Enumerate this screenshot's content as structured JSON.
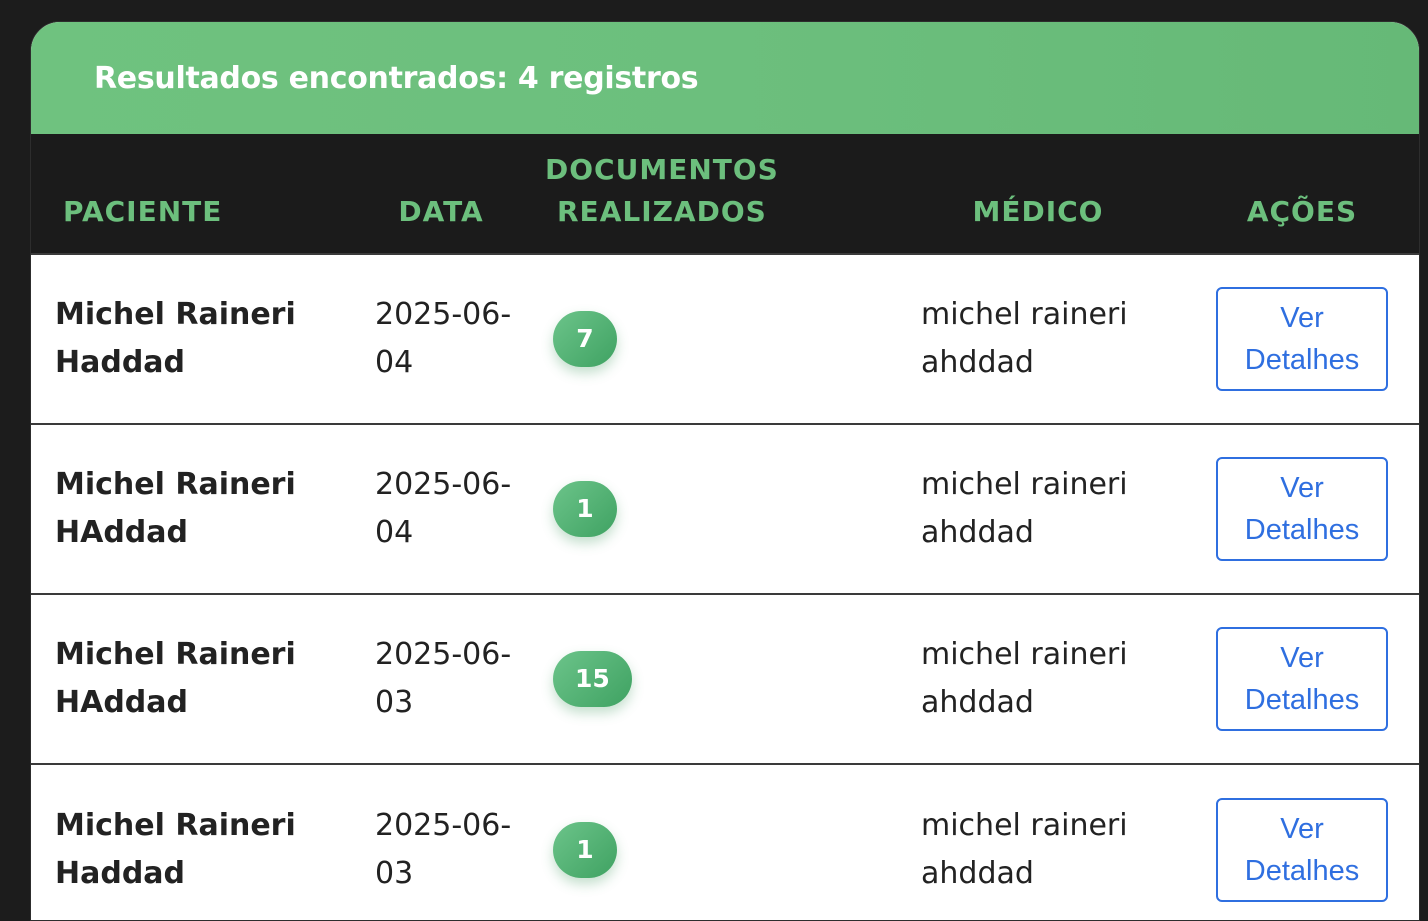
{
  "results": {
    "title": "Resultados encontrados: 4 registros"
  },
  "table": {
    "headers": {
      "paciente": "PACIENTE",
      "data": "DATA",
      "documentos_line1": "DOCUMENTOS",
      "documentos_line2": "REALIZADOS",
      "medico": "MÉDICO",
      "acoes": "AÇÕES"
    },
    "rows": [
      {
        "paciente_line1": "Michel Raineri",
        "paciente_line2": "Haddad",
        "data_line1": "2025-06-",
        "data_line2": "04",
        "documentos": "7",
        "medico_line1": "michel raineri",
        "medico_line2": "ahddad",
        "action_line1": "Ver",
        "action_line2": "Detalhes"
      },
      {
        "paciente_line1": "Michel Raineri",
        "paciente_line2": "HAddad",
        "data_line1": "2025-06-",
        "data_line2": "04",
        "documentos": "1",
        "medico_line1": "michel raineri",
        "medico_line2": "ahddad",
        "action_line1": "Ver",
        "action_line2": "Detalhes"
      },
      {
        "paciente_line1": "Michel Raineri",
        "paciente_line2": "HAddad",
        "data_line1": "2025-06-",
        "data_line2": "03",
        "documentos": "15",
        "medico_line1": "michel raineri",
        "medico_line2": "ahddad",
        "action_line1": "Ver",
        "action_line2": "Detalhes"
      },
      {
        "paciente_line1": "Michel Raineri",
        "paciente_line2": "Haddad",
        "data_line1": "2025-06-",
        "data_line2": "03",
        "documentos": "1",
        "medico_line1": "michel raineri",
        "medico_line2": "ahddad",
        "action_line1": "Ver",
        "action_line2": "Detalhes"
      }
    ]
  },
  "colors": {
    "header_green": "#6cbf7d",
    "table_header_bg": "#1b1b1b",
    "link_blue": "#2f6fe0",
    "badge_green": "#4caf6e"
  }
}
